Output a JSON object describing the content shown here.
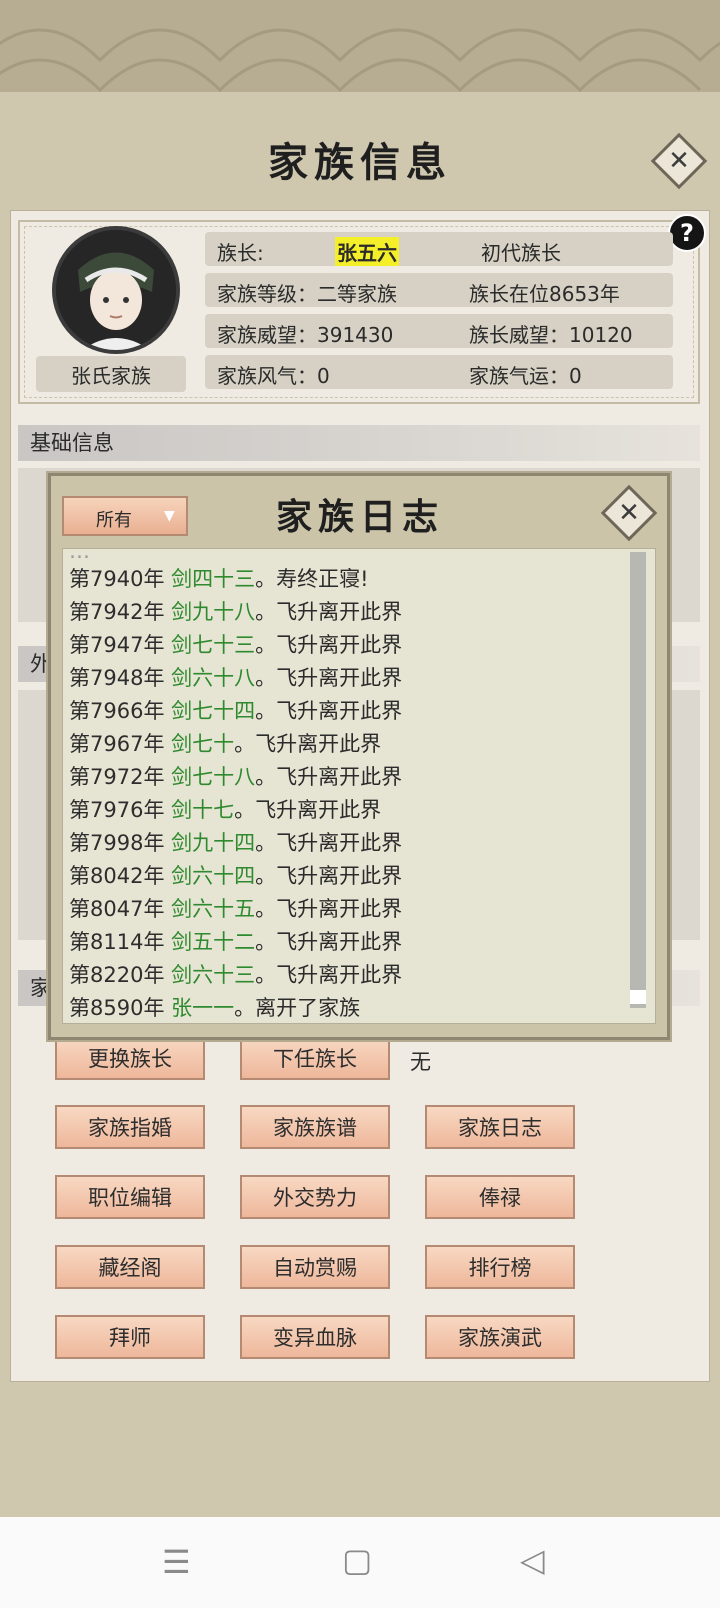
{
  "page": {
    "title": "家族信息",
    "close_icon": "close-icon",
    "help_label": "?"
  },
  "clan": {
    "name": "张氏家族",
    "leader_label": "族长:",
    "leader_name": "张五六",
    "leader_gen": "初代族长",
    "level": "家族等级：二等家族",
    "tenure": "族长在位8653年",
    "prestige": "家族威望：391430",
    "leader_prestige": "族长威望：10120",
    "atmosphere": "家族风气：0",
    "fortune": "家族气运：0"
  },
  "sections": {
    "basic": "基础信息",
    "outer": "外",
    "family": "家"
  },
  "successor": {
    "value": "无"
  },
  "buttons": [
    "更换族长",
    "下任族长",
    "家族指婚",
    "家族族谱",
    "家族日志",
    "职位编辑",
    "外交势力",
    "俸禄",
    "藏经阁",
    "自动赏赐",
    "排行榜",
    "拜师",
    "变异血脉",
    "家族演武"
  ],
  "log_modal": {
    "title": "家族日志",
    "filter_value": "所有",
    "entries": [
      {
        "year": "第7940年",
        "name": "剑四十三",
        "event": "。寿终正寝!"
      },
      {
        "year": "第7942年",
        "name": "剑九十八",
        "event": "。飞升离开此界"
      },
      {
        "year": "第7947年",
        "name": "剑七十三",
        "event": "。飞升离开此界"
      },
      {
        "year": "第7948年",
        "name": "剑六十八",
        "event": "。飞升离开此界"
      },
      {
        "year": "第7966年",
        "name": "剑七十四",
        "event": "。飞升离开此界"
      },
      {
        "year": "第7967年",
        "name": "剑七十",
        "event": "。飞升离开此界"
      },
      {
        "year": "第7972年",
        "name": "剑七十八",
        "event": "。飞升离开此界"
      },
      {
        "year": "第7976年",
        "name": "剑十七",
        "event": "。飞升离开此界"
      },
      {
        "year": "第7998年",
        "name": "剑九十四",
        "event": "。飞升离开此界"
      },
      {
        "year": "第8042年",
        "name": "剑六十四",
        "event": "。飞升离开此界"
      },
      {
        "year": "第8047年",
        "name": "剑六十五",
        "event": "。飞升离开此界"
      },
      {
        "year": "第8114年",
        "name": "剑五十二",
        "event": "。飞升离开此界"
      },
      {
        "year": "第8220年",
        "name": "剑六十三",
        "event": "。飞升离开此界"
      },
      {
        "year": "第8590年",
        "name": "张一一",
        "event": "。离开了家族"
      }
    ]
  },
  "navbar": {
    "menu_icon": "menu-icon",
    "home_icon": "home-icon",
    "back_icon": "back-icon"
  }
}
